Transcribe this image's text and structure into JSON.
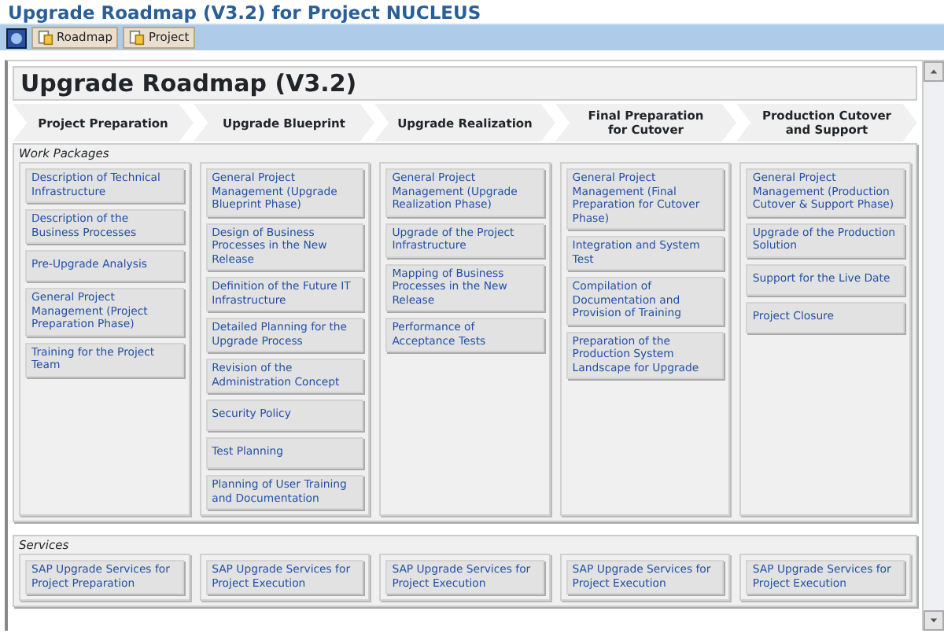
{
  "page_title": "Upgrade Roadmap (V3.2) for Project NUCLEUS",
  "toolbar": [
    {
      "kind": "icon"
    },
    {
      "kind": "button",
      "label": "Roadmap"
    },
    {
      "kind": "button",
      "label": "Project"
    }
  ],
  "heading": "Upgrade Roadmap (V3.2)",
  "phases": [
    "Project Preparation",
    "Upgrade Blueprint",
    "Upgrade Realization",
    "Final Preparation for Cutover",
    "Production Cutover and Support"
  ],
  "work_packages": {
    "label": "Work Packages",
    "columns": [
      [
        "Description of Technical Infrastructure",
        "Description of the Business Processes",
        "Pre-Upgrade Analysis",
        "General Project Management (Project Preparation Phase)",
        "Training for the Project Team"
      ],
      [
        "General Project Management (Upgrade Blueprint Phase)",
        "Design of Business Processes in the New Release",
        "Definition of the Future IT Infrastructure",
        "Detailed Planning for the Upgrade Process",
        "Revision of the Administration Concept",
        "Security Policy",
        "Test Planning",
        "Planning of User Training and Documentation"
      ],
      [
        "General Project Management (Upgrade Realization Phase)",
        "Upgrade of the Project Infrastructure",
        "Mapping of Business Processes in the New Release",
        "Performance of Acceptance Tests"
      ],
      [
        "General Project Management (Final Preparation for Cutover Phase)",
        "Integration and System Test",
        "Compilation of Documentation and Provision of Training",
        "Preparation of the Production System Landscape for Upgrade"
      ],
      [
        "General Project Management (Production Cutover & Support Phase)",
        "Upgrade of the Production Solution",
        "Support for the Live Date",
        "Project Closure"
      ]
    ]
  },
  "services": {
    "label": "Services",
    "items": [
      "SAP Upgrade Services for Project Preparation",
      "SAP Upgrade Services for Project Execution",
      "SAP Upgrade Services for Project Execution",
      "SAP Upgrade Services for Project Execution",
      "SAP Upgrade Services for Project Execution"
    ]
  }
}
